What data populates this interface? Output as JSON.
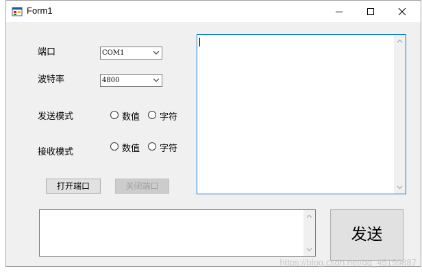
{
  "window": {
    "title": "Form1"
  },
  "titlebar": {
    "minimize_icon": "minimize-icon",
    "maximize_icon": "maximize-icon",
    "close_icon": "close-icon"
  },
  "form": {
    "port_label": "端口",
    "port_value": "COM1",
    "baud_label": "波特率",
    "baud_value": "4800",
    "send_mode_label": "发送模式",
    "send_mode_options": [
      "数值",
      "字符"
    ],
    "recv_mode_label": "接收模式",
    "recv_mode_options": [
      "数值",
      "字符"
    ],
    "open_port_label": "打开端口",
    "close_port_label": "关闭端口",
    "receive_text": "",
    "send_text": "",
    "send_button_label": "发送"
  },
  "watermark": "https://blog.csdn.net/qq_45159887",
  "colors": {
    "window_bg": "#f0f0f0",
    "button_bg": "#e1e1e1",
    "focus_border": "#0078d7"
  }
}
